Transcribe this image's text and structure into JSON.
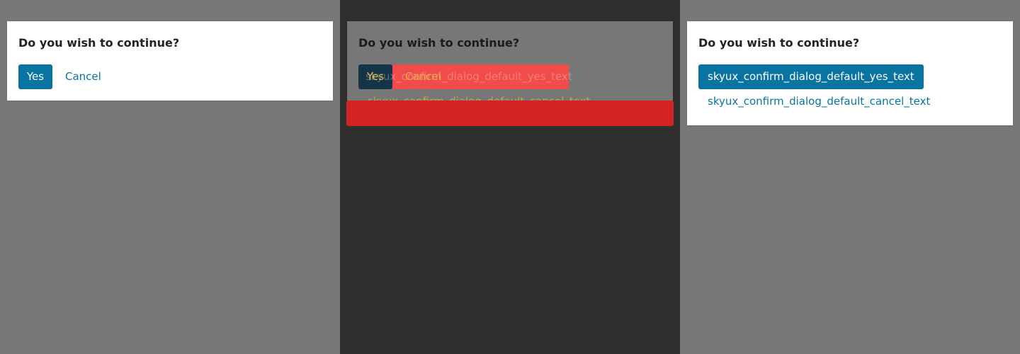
{
  "left_panel": {
    "dialog": {
      "title": "Do you wish to continue?",
      "yes_label": "Yes",
      "cancel_label": "Cancel"
    }
  },
  "middle_panel": {
    "dialog": {
      "title": "Do you wish to continue?",
      "yes_label": "Yes",
      "cancel_label": "Cancel",
      "ghost_yes_text": "skyux_confirm_dialog_default_yes_text",
      "ghost_cancel_text": "skyux_confirm_dialog_default_cancel_text"
    }
  },
  "right_panel": {
    "dialog": {
      "title": "Do you wish to continue?",
      "yes_label": "skyux_confirm_dialog_default_yes_text",
      "cancel_label": "skyux_confirm_dialog_default_cancel_text"
    }
  },
  "colors": {
    "primary": "#0974a1",
    "backdrop": "#777777",
    "diff_background": "#2f2f2f",
    "diff_highlight": "#f14b4b",
    "diff_bar": "#d42323",
    "diff_text": "#e3b23c"
  }
}
